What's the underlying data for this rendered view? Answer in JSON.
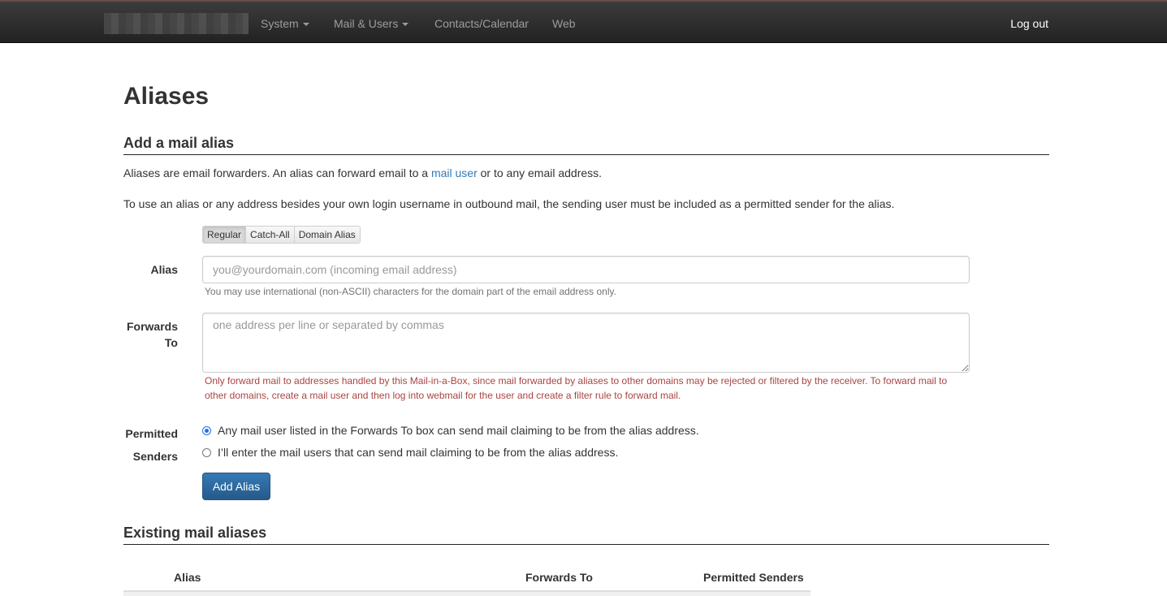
{
  "navbar": {
    "brand_label": "",
    "items": [
      {
        "label": "System",
        "has_caret": true
      },
      {
        "label": "Mail & Users",
        "has_caret": true
      },
      {
        "label": "Contacts/Calendar",
        "has_caret": false
      },
      {
        "label": "Web",
        "has_caret": false
      }
    ],
    "logout_label": "Log out"
  },
  "page": {
    "title": "Aliases"
  },
  "add_section": {
    "heading": "Add a mail alias",
    "intro_before_link": "Aliases are email forwarders. An alias can forward email to a ",
    "intro_link": "mail user",
    "intro_after_link": " or to any email address.",
    "note": "To use an alias or any address besides your own login username in outbound mail, the sending user must be included as a permitted sender for the alias.",
    "mode_buttons": [
      {
        "label": "Regular",
        "active": true
      },
      {
        "label": "Catch-All",
        "active": false
      },
      {
        "label": "Domain Alias",
        "active": false
      }
    ],
    "alias_label": "Alias",
    "alias_placeholder": "you@yourdomain.com (incoming email address)",
    "alias_value": "",
    "alias_help": "You may use international (non-ASCII) characters for the domain part of the email address only.",
    "forwards_label_line1": "Forwards",
    "forwards_label_line2": "To",
    "forwards_placeholder": "one address per line or separated by commas",
    "forwards_value": "",
    "forwards_warning": "Only forward mail to addresses handled by this Mail-in-a-Box, since mail forwarded by aliases to other domains may be rejected or filtered by the receiver. To forward mail to other domains, create a mail user and then log into webmail for the user and create a filter rule to forward mail.",
    "senders_label_line1": "Permitted",
    "senders_label_line2": "Senders",
    "senders_options": [
      {
        "label": "Any mail user listed in the Forwards To box can send mail claiming to be from the alias address.",
        "checked": true
      },
      {
        "label": "I’ll enter the mail users that can send mail claiming to be from the alias address.",
        "checked": false
      }
    ],
    "submit_label": "Add Alias"
  },
  "existing_section": {
    "heading": "Existing mail aliases",
    "columns": [
      "Alias",
      "Forwards To",
      "Permitted Senders"
    ]
  },
  "colors": {
    "navbar_bg": "#222222",
    "link": "#337ab7",
    "primary_button": "#337ab7",
    "warning_text": "#a94442",
    "radio_accent": "#1a73e8"
  }
}
